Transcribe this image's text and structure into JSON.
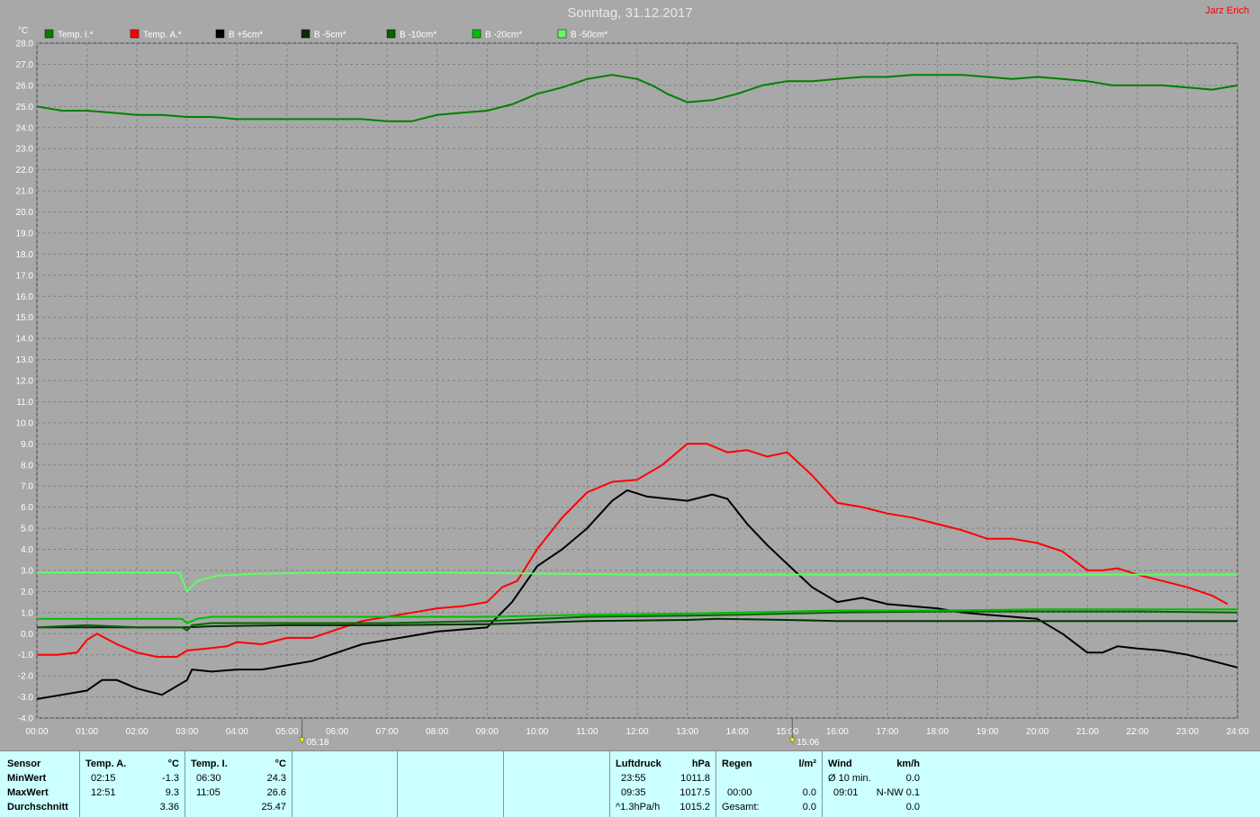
{
  "header": {
    "title": "Sonntag, 31.12.2017",
    "author": "Jarz Erich"
  },
  "colors": {
    "bg": "#a8a8a8",
    "grid": "#808080",
    "axis_text": "#ffffff"
  },
  "chart_data": {
    "type": "line",
    "ylabel": "°C",
    "ylim": [
      -4.0,
      28.0
    ],
    "xlim": [
      0,
      24
    ],
    "x_ticks": [
      "00:00",
      "01:00",
      "02:00",
      "03:00",
      "04:00",
      "05:00",
      "06:00",
      "07:00",
      "08:00",
      "09:00",
      "10:00",
      "11:00",
      "12:00",
      "13:00",
      "14:00",
      "15:00",
      "16:00",
      "17:00",
      "18:00",
      "19:00",
      "20:00",
      "21:00",
      "22:00",
      "23:00",
      "24:00"
    ],
    "y_ticks": [
      "-4.0",
      "-3.0",
      "-2.0",
      "-1.0",
      "0.0",
      "1.0",
      "2.0",
      "3.0",
      "4.0",
      "5.0",
      "6.0",
      "7.0",
      "8.0",
      "9.0",
      "10.0",
      "11.0",
      "12.0",
      "13.0",
      "14.0",
      "15.0",
      "16.0",
      "17.0",
      "18.0",
      "19.0",
      "20.0",
      "21.0",
      "22.0",
      "23.0",
      "24.0",
      "25.0",
      "26.0",
      "27.0",
      "28.0"
    ],
    "markers": [
      {
        "label": "05:18",
        "x": 5.3,
        "icon": "sunrise-icon"
      },
      {
        "label": "15:06",
        "x": 15.1,
        "icon": "sunset-icon"
      }
    ],
    "series": [
      {
        "name": "Temp. I.*",
        "color": "#008000",
        "x": [
          0,
          0.5,
          1,
          1.5,
          2,
          2.5,
          3,
          3.5,
          4,
          4.5,
          5,
          5.5,
          6,
          6.5,
          7,
          7.5,
          8,
          8.5,
          9,
          9.5,
          10,
          10.5,
          11,
          11.5,
          12,
          12.3,
          12.6,
          13,
          13.5,
          14,
          14.5,
          15,
          15.5,
          16,
          16.5,
          17,
          17.5,
          18,
          18.5,
          19,
          19.5,
          20,
          20.5,
          21,
          21.5,
          22,
          22.5,
          23,
          23.5,
          24
        ],
        "values": [
          25.0,
          24.8,
          24.8,
          24.7,
          24.6,
          24.6,
          24.5,
          24.5,
          24.4,
          24.4,
          24.4,
          24.4,
          24.4,
          24.4,
          24.3,
          24.3,
          24.6,
          24.7,
          24.8,
          25.1,
          25.6,
          25.9,
          26.3,
          26.5,
          26.3,
          26.0,
          25.6,
          25.2,
          25.3,
          25.6,
          26.0,
          26.2,
          26.2,
          26.3,
          26.4,
          26.4,
          26.5,
          26.5,
          26.5,
          26.4,
          26.3,
          26.4,
          26.3,
          26.2,
          26.0,
          26.0,
          26.0,
          25.9,
          25.8,
          26.0
        ]
      },
      {
        "name": "Temp. A.*",
        "color": "#ff0000",
        "x": [
          0,
          0.4,
          0.8,
          1.0,
          1.2,
          1.6,
          2.0,
          2.4,
          2.8,
          3.0,
          3.4,
          3.8,
          4.0,
          4.5,
          5.0,
          5.5,
          6.0,
          6.5,
          7.0,
          7.5,
          8.0,
          8.5,
          9.0,
          9.3,
          9.6,
          10.0,
          10.5,
          11.0,
          11.5,
          12.0,
          12.5,
          13.0,
          13.4,
          13.8,
          14.2,
          14.6,
          15.0,
          15.5,
          16.0,
          16.5,
          17.0,
          17.5,
          18.0,
          18.5,
          19.0,
          19.5,
          20.0,
          20.5,
          21.0,
          21.3,
          21.6,
          22.0,
          22.5,
          23.0,
          23.5,
          23.8
        ],
        "values": [
          -1.0,
          -1.0,
          -0.9,
          -0.3,
          0.0,
          -0.5,
          -0.9,
          -1.1,
          -1.1,
          -0.8,
          -0.7,
          -0.6,
          -0.4,
          -0.5,
          -0.2,
          -0.2,
          0.2,
          0.6,
          0.8,
          1.0,
          1.2,
          1.3,
          1.5,
          2.2,
          2.5,
          4.0,
          5.5,
          6.7,
          7.2,
          7.3,
          8.0,
          9.0,
          9.0,
          8.6,
          8.7,
          8.4,
          8.6,
          7.5,
          6.2,
          6.0,
          5.7,
          5.5,
          5.2,
          4.9,
          4.5,
          4.5,
          4.3,
          3.9,
          3.0,
          3.0,
          3.1,
          2.8,
          2.5,
          2.2,
          1.8,
          1.4
        ]
      },
      {
        "name": "B +5cm*",
        "color": "#000000",
        "x": [
          0,
          0.5,
          1,
          1.3,
          1.6,
          2,
          2.5,
          3,
          3.1,
          3.5,
          4,
          4.5,
          5,
          5.5,
          6,
          6.5,
          7,
          7.5,
          8,
          8.5,
          9,
          9.5,
          10,
          10.5,
          11,
          11.5,
          11.8,
          12.2,
          12.6,
          13,
          13.5,
          13.8,
          14.2,
          14.6,
          15,
          15.5,
          16,
          16.5,
          17,
          17.5,
          18,
          18.5,
          19,
          19.5,
          20,
          20.5,
          21,
          21.3,
          21.6,
          22,
          22.5,
          23,
          23.5,
          24
        ],
        "values": [
          -3.1,
          -2.9,
          -2.7,
          -2.2,
          -2.2,
          -2.6,
          -2.9,
          -2.2,
          -1.7,
          -1.8,
          -1.7,
          -1.7,
          -1.5,
          -1.3,
          -0.9,
          -0.5,
          -0.3,
          -0.1,
          0.1,
          0.2,
          0.3,
          1.5,
          3.2,
          4.0,
          5.0,
          6.3,
          6.8,
          6.5,
          6.4,
          6.3,
          6.6,
          6.4,
          5.2,
          4.2,
          3.3,
          2.2,
          1.5,
          1.7,
          1.4,
          1.3,
          1.2,
          1.0,
          0.9,
          0.8,
          0.7,
          0.0,
          -0.9,
          -0.9,
          -0.6,
          -0.7,
          -0.8,
          -1.0,
          -1.3,
          -1.6
        ]
      },
      {
        "name": "B -5cm*",
        "color": "#003000",
        "x": [
          0,
          1,
          2,
          3,
          3.5,
          5,
          7,
          9,
          11,
          13,
          13.6,
          15,
          16,
          18,
          20,
          22,
          24
        ],
        "values": [
          0.3,
          0.3,
          0.3,
          0.3,
          0.35,
          0.4,
          0.4,
          0.45,
          0.6,
          0.65,
          0.7,
          0.65,
          0.6,
          0.6,
          0.6,
          0.6,
          0.6
        ]
      },
      {
        "name": "B -10cm*",
        "color": "#006400",
        "x": [
          0,
          1,
          2,
          2.9,
          3.0,
          3.1,
          3.5,
          5,
          7,
          9,
          11,
          13,
          14,
          16,
          18,
          20,
          22,
          24
        ],
        "values": [
          0.3,
          0.4,
          0.3,
          0.3,
          0.15,
          0.4,
          0.5,
          0.5,
          0.5,
          0.6,
          0.8,
          0.85,
          0.9,
          1.0,
          1.05,
          1.05,
          1.05,
          1.0
        ]
      },
      {
        "name": "B -20cm*",
        "color": "#00c000",
        "x": [
          0,
          1,
          2,
          2.9,
          3.0,
          3.2,
          3.5,
          5,
          7,
          9,
          11,
          13,
          14,
          16,
          18,
          20,
          22,
          24
        ],
        "values": [
          0.7,
          0.7,
          0.7,
          0.7,
          0.5,
          0.7,
          0.8,
          0.8,
          0.8,
          0.8,
          0.9,
          0.95,
          1.0,
          1.1,
          1.1,
          1.15,
          1.15,
          1.15
        ]
      },
      {
        "name": "B -50cm*",
        "color": "#60ff60",
        "x": [
          0,
          1,
          2,
          2.85,
          3.0,
          3.2,
          3.6,
          4.5,
          6,
          8,
          10,
          12,
          14,
          16,
          18,
          20,
          22,
          24
        ],
        "values": [
          2.9,
          2.9,
          2.9,
          2.9,
          2.0,
          2.5,
          2.75,
          2.85,
          2.9,
          2.9,
          2.85,
          2.8,
          2.8,
          2.8,
          2.8,
          2.8,
          2.8,
          2.8
        ]
      }
    ]
  },
  "stats": {
    "col1": {
      "h": "Sensor",
      "r1": "MinWert",
      "r2": "MaxWert",
      "r3": "Durchschnitt"
    },
    "col2": {
      "h": "Temp. A.",
      "unit": "°C",
      "min_time": "02:15",
      "min_val": "-1.3",
      "max_time": "12:51",
      "max_val": "9.3",
      "avg": "3.36"
    },
    "col3": {
      "h": "Temp. I.",
      "unit": "°C",
      "min_time": "06:30",
      "min_val": "24.3",
      "max_time": "11:05",
      "max_val": "26.6",
      "avg": "25.47"
    },
    "pressure": {
      "h": "Luftdruck",
      "unit": "hPa",
      "min_time": "23:55",
      "min_val": "1011.8",
      "max_time": "09:35",
      "max_val": "1017.5",
      "trend": "^1.3hPa/h",
      "avg": "1015.2"
    },
    "rain": {
      "h": "Regen",
      "unit": "l/m²",
      "max_time": "00:00",
      "max_val": "0.0",
      "total_label": "Gesamt:",
      "total": "0.0"
    },
    "wind": {
      "h": "Wind",
      "unit": "km/h",
      "min_label": "Ø 10 min.",
      "min_val": "0.0",
      "max_time": "09:01",
      "max_val": "N-NW 0.1",
      "avg": "0.0"
    }
  }
}
